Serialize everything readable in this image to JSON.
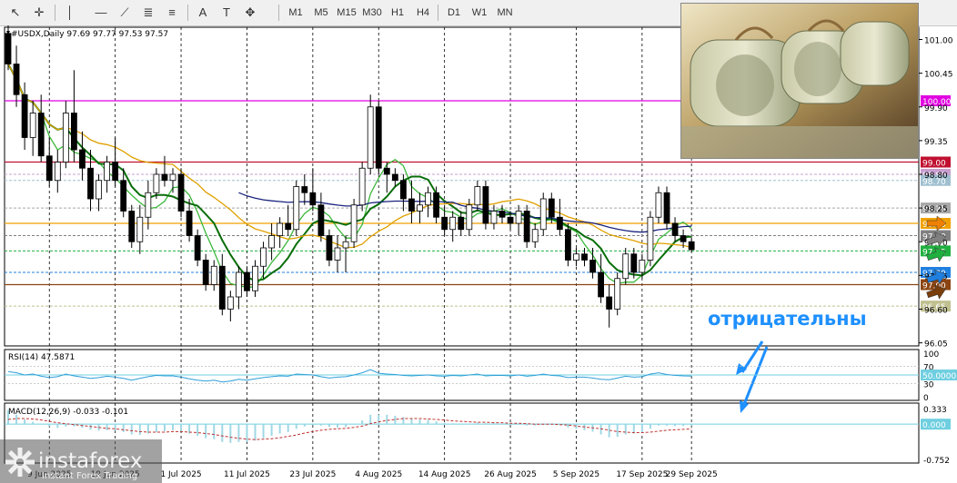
{
  "toolbar": {
    "tools": [
      {
        "name": "cursor-icon",
        "glyph": "↖"
      },
      {
        "name": "crosshair-icon",
        "glyph": "✛"
      },
      {
        "name": "vertical-line-icon",
        "glyph": "│"
      },
      {
        "name": "horizontal-line-icon",
        "glyph": "—"
      },
      {
        "name": "trendline-icon",
        "glyph": "⟋"
      },
      {
        "name": "channel-icon",
        "glyph": "≣"
      },
      {
        "name": "fibonacci-icon",
        "glyph": "≡"
      },
      {
        "name": "text-icon",
        "glyph": "A"
      },
      {
        "name": "label-icon",
        "glyph": "T"
      },
      {
        "name": "arrows-icon",
        "glyph": "✥"
      }
    ],
    "timeframes": [
      "M1",
      "M5",
      "M15",
      "M30",
      "H1",
      "H4",
      "D1",
      "W1",
      "MN"
    ]
  },
  "chart_data": {
    "type": "candlestick",
    "symbol_header": "#USDX,Daily  97.69 97.77 97.53 97.57",
    "y_range": [
      96.0,
      101.2
    ],
    "y_ticks": [
      101.0,
      100.45,
      99.9,
      99.35,
      98.8,
      98.25,
      97.7,
      97.15,
      96.6,
      96.05
    ],
    "x_labels": [
      "9 Jun 2025",
      "19 Jun 2025",
      "1 Jul 2025",
      "11 Jul 2025",
      "23 Jul 2025",
      "4 Aug 2025",
      "14 Aug 2025",
      "26 Aug 2025",
      "5 Sep 2025",
      "17 Sep 2025",
      "29 Sep 2025"
    ],
    "date_start": "2025-06-02",
    "candles": [
      [
        101.1,
        101.4,
        100.5,
        100.6
      ],
      [
        100.6,
        100.9,
        99.9,
        100.1
      ],
      [
        100.1,
        100.3,
        99.2,
        99.4
      ],
      [
        99.4,
        100.0,
        99.1,
        99.8
      ],
      [
        99.8,
        100.1,
        99.0,
        99.1
      ],
      [
        99.1,
        99.4,
        98.6,
        98.7
      ],
      [
        98.7,
        99.2,
        98.5,
        99.0
      ],
      [
        99.0,
        100.0,
        98.9,
        99.8
      ],
      [
        99.8,
        100.5,
        99.0,
        99.2
      ],
      [
        99.2,
        99.5,
        98.7,
        98.9
      ],
      [
        98.9,
        99.2,
        98.2,
        98.4
      ],
      [
        98.4,
        98.8,
        98.2,
        98.7
      ],
      [
        98.7,
        99.1,
        98.5,
        99.0
      ],
      [
        99.0,
        99.4,
        98.6,
        98.7
      ],
      [
        98.7,
        98.9,
        98.1,
        98.2
      ],
      [
        98.2,
        98.3,
        97.6,
        97.7
      ],
      [
        97.7,
        98.3,
        97.5,
        98.1
      ],
      [
        98.1,
        98.7,
        97.9,
        98.5
      ],
      [
        98.5,
        98.9,
        98.4,
        98.8
      ],
      [
        98.8,
        99.1,
        98.6,
        98.7
      ],
      [
        98.7,
        98.9,
        98.5,
        98.8
      ],
      [
        98.8,
        98.9,
        98.1,
        98.2
      ],
      [
        98.2,
        98.4,
        97.7,
        97.8
      ],
      [
        97.8,
        97.9,
        97.3,
        97.4
      ],
      [
        97.4,
        97.5,
        96.9,
        97.0
      ],
      [
        97.0,
        97.4,
        96.9,
        97.3
      ],
      [
        97.3,
        97.5,
        96.5,
        96.6
      ],
      [
        96.6,
        96.9,
        96.4,
        96.8
      ],
      [
        96.8,
        97.3,
        96.6,
        97.2
      ],
      [
        97.2,
        97.3,
        96.8,
        96.9
      ],
      [
        96.9,
        97.4,
        96.8,
        97.3
      ],
      [
        97.3,
        97.7,
        97.1,
        97.6
      ],
      [
        97.6,
        98.0,
        97.4,
        97.8
      ],
      [
        97.8,
        98.1,
        97.6,
        98.0
      ],
      [
        98.0,
        98.3,
        97.8,
        97.9
      ],
      [
        97.9,
        98.7,
        97.8,
        98.6
      ],
      [
        98.6,
        98.8,
        98.3,
        98.5
      ],
      [
        98.5,
        98.9,
        98.2,
        98.3
      ],
      [
        98.3,
        98.5,
        97.7,
        97.8
      ],
      [
        97.8,
        97.9,
        97.3,
        97.4
      ],
      [
        97.4,
        97.8,
        97.2,
        97.6
      ],
      [
        97.6,
        97.8,
        97.2,
        97.7
      ],
      [
        97.7,
        98.4,
        97.6,
        98.3
      ],
      [
        98.3,
        99.0,
        98.2,
        98.9
      ],
      [
        98.9,
        100.1,
        98.8,
        99.9
      ],
      [
        99.9,
        100.0,
        98.8,
        98.9
      ],
      [
        98.9,
        99.0,
        98.5,
        98.8
      ],
      [
        98.8,
        98.9,
        98.6,
        98.7
      ],
      [
        98.7,
        98.8,
        98.2,
        98.4
      ],
      [
        98.4,
        98.7,
        98.0,
        98.2
      ],
      [
        98.2,
        98.5,
        98.0,
        98.3
      ],
      [
        98.3,
        98.6,
        98.1,
        98.5
      ],
      [
        98.5,
        98.6,
        98.0,
        98.1
      ],
      [
        98.1,
        98.3,
        97.8,
        97.9
      ],
      [
        97.9,
        98.2,
        97.7,
        98.1
      ],
      [
        98.1,
        98.2,
        97.8,
        97.9
      ],
      [
        97.9,
        98.4,
        97.8,
        98.3
      ],
      [
        98.3,
        98.7,
        98.2,
        98.6
      ],
      [
        98.6,
        98.7,
        97.9,
        98.0
      ],
      [
        98.0,
        98.3,
        97.9,
        98.2
      ],
      [
        98.2,
        98.3,
        98.0,
        98.1
      ],
      [
        98.1,
        98.2,
        97.9,
        98.0
      ],
      [
        98.0,
        98.3,
        97.8,
        98.2
      ],
      [
        98.2,
        98.3,
        97.6,
        97.7
      ],
      [
        97.7,
        98.0,
        97.6,
        97.9
      ],
      [
        97.9,
        98.5,
        97.8,
        98.4
      ],
      [
        98.4,
        98.5,
        98.0,
        98.1
      ],
      [
        98.1,
        98.4,
        97.8,
        97.9
      ],
      [
        97.9,
        98.0,
        97.3,
        97.4
      ],
      [
        97.4,
        97.6,
        97.3,
        97.5
      ],
      [
        97.5,
        97.6,
        97.3,
        97.4
      ],
      [
        97.4,
        97.6,
        97.1,
        97.2
      ],
      [
        97.2,
        97.5,
        96.7,
        96.8
      ],
      [
        96.8,
        97.0,
        96.3,
        96.6
      ],
      [
        96.6,
        97.2,
        96.5,
        97.1
      ],
      [
        97.1,
        97.6,
        97.0,
        97.5
      ],
      [
        97.5,
        97.6,
        97.1,
        97.2
      ],
      [
        97.2,
        97.5,
        97.1,
        97.4
      ],
      [
        97.4,
        98.2,
        97.3,
        98.1
      ],
      [
        98.1,
        98.6,
        98.0,
        98.5
      ],
      [
        98.5,
        98.6,
        97.9,
        98.0
      ],
      [
        98.0,
        98.1,
        97.7,
        97.8
      ],
      [
        97.8,
        97.9,
        97.6,
        97.7
      ],
      [
        97.7,
        97.77,
        97.53,
        97.57
      ]
    ],
    "horizontal_levels": [
      {
        "value": 100.0,
        "label": "100.00",
        "color": "#e000e0"
      },
      {
        "value": 99.0,
        "label": "99.00",
        "color": "#c01030"
      },
      {
        "value": 98.8,
        "label": "98.80",
        "color": "#c8a0d0"
      },
      {
        "value": 98.7,
        "label": "98.70",
        "color": "#a0c0d0"
      },
      {
        "value": 98.25,
        "label": "98.25",
        "color": "#a8a8a8"
      },
      {
        "value": 98.0,
        "label": "98.00",
        "color": "#f0a000"
      },
      {
        "value": 97.8,
        "label": "97.80",
        "color": "#808080"
      },
      {
        "value": 97.55,
        "label": "97.55",
        "color": "#20b040"
      },
      {
        "value": 97.2,
        "label": "97.20",
        "color": "#2080e0"
      },
      {
        "value": 97.0,
        "label": "97.00",
        "color": "#8b4513"
      },
      {
        "value": 96.65,
        "label": "96.65",
        "color": "#c0c090"
      }
    ],
    "level_arrows": [
      "#f08000",
      "#808080",
      "#20b040",
      "#2080e0",
      "#7a3e0a"
    ],
    "annotation": "отрицательны",
    "annotation_color": "#1e90ff",
    "moving_averages": [
      {
        "period": 5,
        "color": "#3cb83c"
      },
      {
        "period": 8,
        "color": "#0a6e0a"
      },
      {
        "period": 21,
        "color": "#e0a000"
      },
      {
        "period": 55,
        "color": "#1a237e"
      }
    ],
    "rsi": {
      "header": "RSI(14) 47.5871",
      "ticks": [
        "100",
        "70",
        "30",
        "0"
      ],
      "current_label": "50.0000",
      "values": [
        58,
        55,
        50,
        52,
        47,
        44,
        46,
        52,
        48,
        45,
        42,
        44,
        47,
        45,
        42,
        38,
        42,
        46,
        49,
        48,
        48,
        45,
        41,
        38,
        36,
        38,
        34,
        36,
        40,
        38,
        41,
        44,
        46,
        48,
        47,
        52,
        51,
        50,
        46,
        43,
        45,
        46,
        50,
        55,
        62,
        54,
        52,
        51,
        49,
        48,
        49,
        50,
        48,
        47,
        49,
        48,
        50,
        52,
        48,
        49,
        49,
        48,
        50,
        47,
        49,
        52,
        49,
        48,
        44,
        45,
        45,
        43,
        40,
        39,
        43,
        47,
        45,
        46,
        52,
        55,
        51,
        49,
        48,
        47.6
      ]
    },
    "macd": {
      "header": "MACD(12,26,9) -0.033 -0.101",
      "ticks": [
        "0.333",
        "0.000",
        "-0.752"
      ],
      "current_label": "0.000",
      "histogram": [
        0.3,
        0.2,
        0.1,
        0.05,
        0.0,
        -0.05,
        -0.08,
        -0.05,
        -0.05,
        -0.08,
        -0.12,
        -0.14,
        -0.13,
        -0.14,
        -0.17,
        -0.22,
        -0.23,
        -0.2,
        -0.17,
        -0.15,
        -0.13,
        -0.15,
        -0.2,
        -0.25,
        -0.3,
        -0.32,
        -0.38,
        -0.4,
        -0.38,
        -0.38,
        -0.35,
        -0.3,
        -0.25,
        -0.2,
        -0.17,
        -0.1,
        -0.05,
        -0.02,
        -0.03,
        -0.06,
        -0.07,
        -0.06,
        0.0,
        0.08,
        0.2,
        0.2,
        0.2,
        0.18,
        0.15,
        0.12,
        0.1,
        0.09,
        0.06,
        0.03,
        0.02,
        0.0,
        0.01,
        0.03,
        0.02,
        0.02,
        0.01,
        0.0,
        0.0,
        -0.03,
        -0.03,
        0.0,
        0.0,
        -0.02,
        -0.07,
        -0.1,
        -0.13,
        -0.16,
        -0.22,
        -0.28,
        -0.27,
        -0.22,
        -0.2,
        -0.18,
        -0.1,
        -0.03,
        -0.03,
        -0.04,
        -0.04,
        -0.033
      ],
      "signal": [
        0.1,
        0.12,
        0.12,
        0.11,
        0.09,
        0.06,
        0.03,
        0.01,
        -0.01,
        -0.03,
        -0.05,
        -0.07,
        -0.09,
        -0.1,
        -0.12,
        -0.14,
        -0.16,
        -0.17,
        -0.17,
        -0.17,
        -0.16,
        -0.16,
        -0.17,
        -0.18,
        -0.2,
        -0.22,
        -0.25,
        -0.28,
        -0.3,
        -0.32,
        -0.33,
        -0.32,
        -0.31,
        -0.29,
        -0.26,
        -0.23,
        -0.19,
        -0.16,
        -0.13,
        -0.11,
        -0.1,
        -0.09,
        -0.07,
        -0.04,
        0.01,
        0.05,
        0.08,
        0.1,
        0.12,
        0.12,
        0.12,
        0.11,
        0.1,
        0.09,
        0.07,
        0.06,
        0.05,
        0.04,
        0.04,
        0.03,
        0.03,
        0.02,
        0.02,
        0.01,
        0.0,
        0.0,
        0.0,
        -0.01,
        -0.02,
        -0.04,
        -0.06,
        -0.08,
        -0.1,
        -0.13,
        -0.16,
        -0.17,
        -0.18,
        -0.18,
        -0.17,
        -0.15,
        -0.13,
        -0.12,
        -0.11,
        -0.101
      ]
    }
  },
  "watermark": {
    "brand": "instaforex",
    "tagline": "Instant Forex Trading"
  },
  "colors": {
    "bull": "#ffffff",
    "bear": "#000000",
    "rsi_line": "#2f9ed8",
    "macd_hist": "#9fd8e4",
    "macd_signal": "#c03030"
  }
}
